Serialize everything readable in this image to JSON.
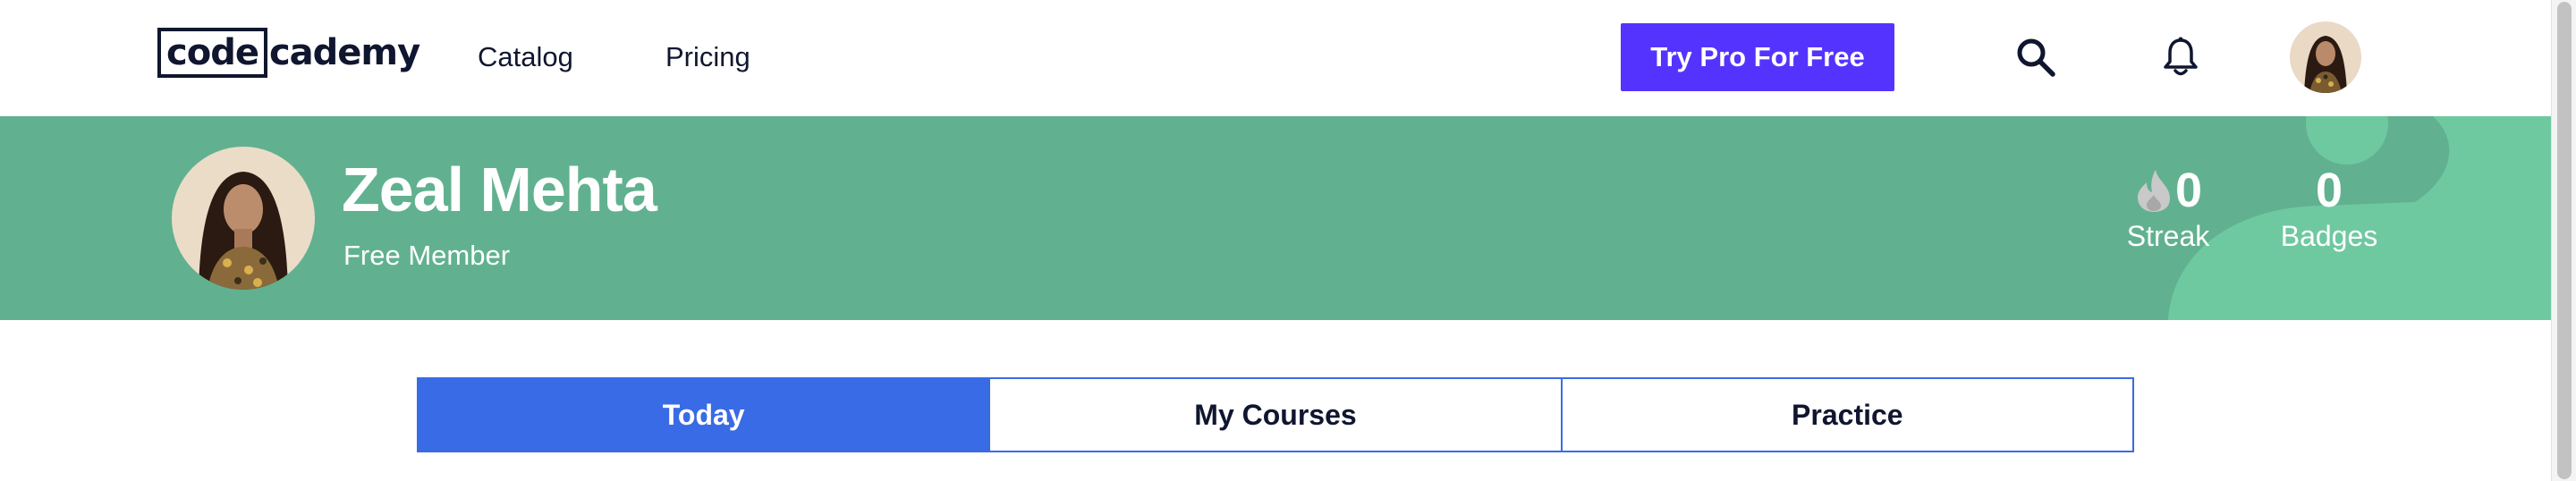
{
  "nav": {
    "logo_part1": "code",
    "logo_part2": "cademy",
    "links": [
      {
        "label": "Catalog"
      },
      {
        "label": "Pricing"
      }
    ],
    "cta_label": "Try Pro For Free",
    "icons": {
      "search": "search-icon",
      "notifications": "bell-icon",
      "avatar": "user-avatar"
    }
  },
  "profile": {
    "name": "Zeal Mehta",
    "membership": "Free Member",
    "stats": [
      {
        "value": "0",
        "label": "Streak",
        "icon": "flame-icon"
      },
      {
        "value": "0",
        "label": "Badges"
      }
    ]
  },
  "tabs": [
    {
      "label": "Today",
      "active": true
    },
    {
      "label": "My Courses",
      "active": false
    },
    {
      "label": "Practice",
      "active": false
    }
  ],
  "colors": {
    "brand_dark": "#10162f",
    "cta": "#5533ff",
    "banner": "#61b190",
    "banner_accent": "#6fc9a0",
    "tab_accent": "#3a6be6"
  }
}
